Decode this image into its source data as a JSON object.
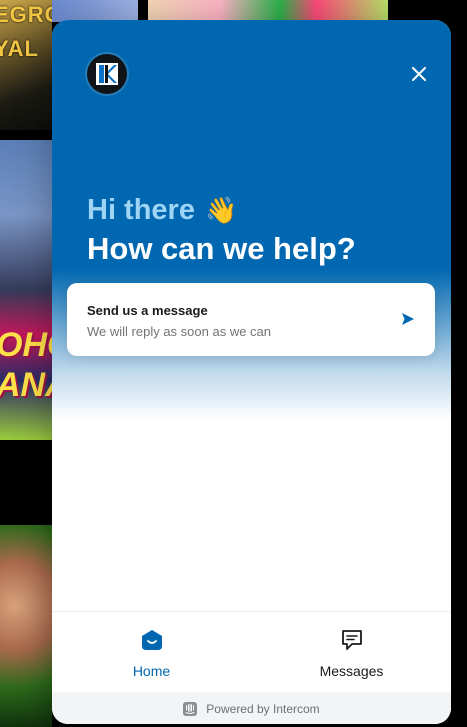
{
  "background": {
    "tile1_text": "EGROUND\nYAL",
    "tile2_text": "OHC\nANA"
  },
  "messenger": {
    "greeting_line1": "Hi there",
    "greeting_emoji": "👋",
    "greeting_line2": "How can we help?",
    "send_card": {
      "title": "Send us a message",
      "subtitle": "We will reply as soon as we can"
    },
    "tabs": [
      {
        "label": "Home",
        "icon": "home-icon",
        "active": true
      },
      {
        "label": "Messages",
        "icon": "messages-icon",
        "active": false
      }
    ],
    "powered_by": "Powered by Intercom",
    "colors": {
      "brand": "#0067b0",
      "accent_text": "#9ed4f4"
    }
  }
}
